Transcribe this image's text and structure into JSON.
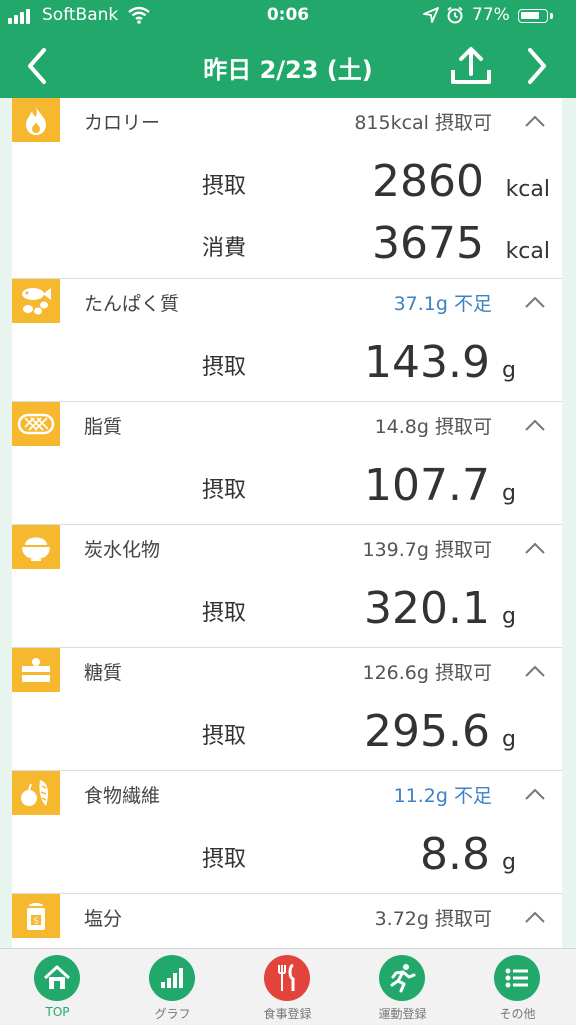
{
  "status_bar": {
    "carrier": "SoftBank",
    "time": "0:06",
    "battery_percent": "77%",
    "battery_level": 0.77
  },
  "nav": {
    "title": "昨日 2/23 (土)"
  },
  "colors": {
    "primary_green": "#23a86c",
    "icon_yellow": "#f5b82e",
    "deficit_blue": "#3d82c4",
    "tab_red": "#e2443b"
  },
  "sections": [
    {
      "name": "カロリー",
      "icon": "flame-icon",
      "status": "815kcal 摂取可",
      "rows": [
        {
          "label": "摂取",
          "value": "2860",
          "unit": "kcal"
        },
        {
          "label": "消費",
          "value": "3675",
          "unit": "kcal"
        }
      ]
    },
    {
      "name": "たんぱく質",
      "icon": "fish-beans-icon",
      "status": "37.1g 不足",
      "rows": [
        {
          "label": "摂取",
          "value": "143.9",
          "unit": "g"
        }
      ]
    },
    {
      "name": "脂質",
      "icon": "fat-icon",
      "status": "14.8g 摂取可",
      "rows": [
        {
          "label": "摂取",
          "value": "107.7",
          "unit": "g"
        }
      ]
    },
    {
      "name": "炭水化物",
      "icon": "rice-bowl-icon",
      "status": "139.7g 摂取可",
      "rows": [
        {
          "label": "摂取",
          "value": "320.1",
          "unit": "g"
        }
      ]
    },
    {
      "name": "糖質",
      "icon": "cake-icon",
      "status": "126.6g 摂取可",
      "rows": [
        {
          "label": "摂取",
          "value": "295.6",
          "unit": "g"
        }
      ]
    },
    {
      "name": "食物繊維",
      "icon": "apple-vegetable-icon",
      "status": "11.2g 不足",
      "rows": [
        {
          "label": "摂取",
          "value": "8.8",
          "unit": "g"
        }
      ]
    },
    {
      "name": "塩分",
      "icon": "salt-shaker-icon",
      "status": "3.72g 摂取可",
      "rows": []
    }
  ],
  "tabs": [
    {
      "label": "TOP",
      "icon": "home-icon"
    },
    {
      "label": "グラフ",
      "icon": "bar-chart-icon"
    },
    {
      "label": "食事登録",
      "icon": "fork-knife-icon"
    },
    {
      "label": "運動登録",
      "icon": "runner-icon"
    },
    {
      "label": "その他",
      "icon": "list-icon"
    }
  ]
}
